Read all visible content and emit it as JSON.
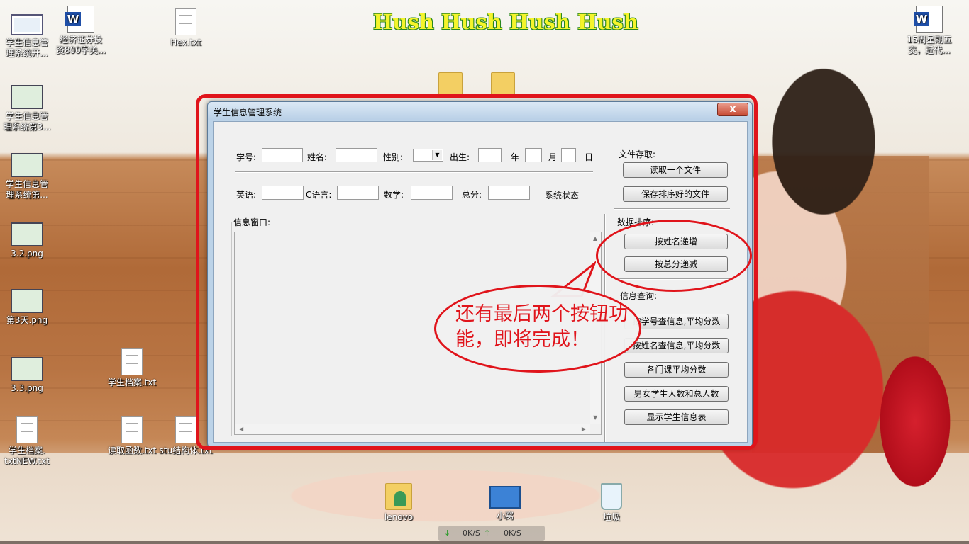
{
  "desktop": {
    "banner": "Hush Hush Hush Hush",
    "icons": [
      {
        "label": "学生信息管\n理系统开..."
      },
      {
        "label": "经济证券投\n资800字关..."
      },
      {
        "label": "Hex.txt"
      },
      {
        "label": "15周星期五\n交，近代..."
      },
      {
        "label": "学生信息管\n理系统第3..."
      },
      {
        "label": "学生信息管\n理系统第..."
      },
      {
        "label": "3.2.png"
      },
      {
        "label": "第3天.png"
      },
      {
        "label": "3.3.png"
      },
      {
        "label": "学生档案.txt"
      },
      {
        "label": "学生档案.\ntxtNEW.txt"
      },
      {
        "label": "读取函数.txt"
      },
      {
        "label": "stu结构体.txt"
      },
      {
        "label": "lenovo"
      },
      {
        "label": "小窝"
      },
      {
        "label": "垃圾"
      }
    ],
    "net_speed": {
      "down": "0K/S",
      "up": "0K/S"
    }
  },
  "dialog": {
    "title": "学生信息管理系统",
    "close_symbol": "x",
    "row1": {
      "student_id_label": "学号:",
      "name_label": "姓名:",
      "gender_label": "性别:",
      "birth_label": "出生:",
      "year_label": "年",
      "month_label": "月",
      "day_label": "日"
    },
    "row2": {
      "english_label": "英语:",
      "c_label": "C语言:",
      "math_label": "数学:",
      "total_label": "总分:",
      "status_label": "系统状态"
    },
    "info_window_label": "信息窗口:",
    "file_section": {
      "title": "文件存取:",
      "read_button": "读取一个文件",
      "save_button": "保存排序好的文件"
    },
    "sort_section": {
      "title": "数据排序:",
      "by_name_button": "按姓名递增",
      "by_total_button": "按总分递减"
    },
    "query_section": {
      "title": "信息查询:",
      "by_id_button": "按学号查信息,平均分数",
      "by_name_button": "按姓名查信息,平均分数",
      "course_avg_button": "各门课平均分数",
      "gender_count_button": "男女学生人数和总人数",
      "show_table_button": "显示学生信息表"
    }
  },
  "annotation": {
    "bubble_text": "还有最后两个按钮功能，即将完成！",
    "color": "#e0141b"
  }
}
